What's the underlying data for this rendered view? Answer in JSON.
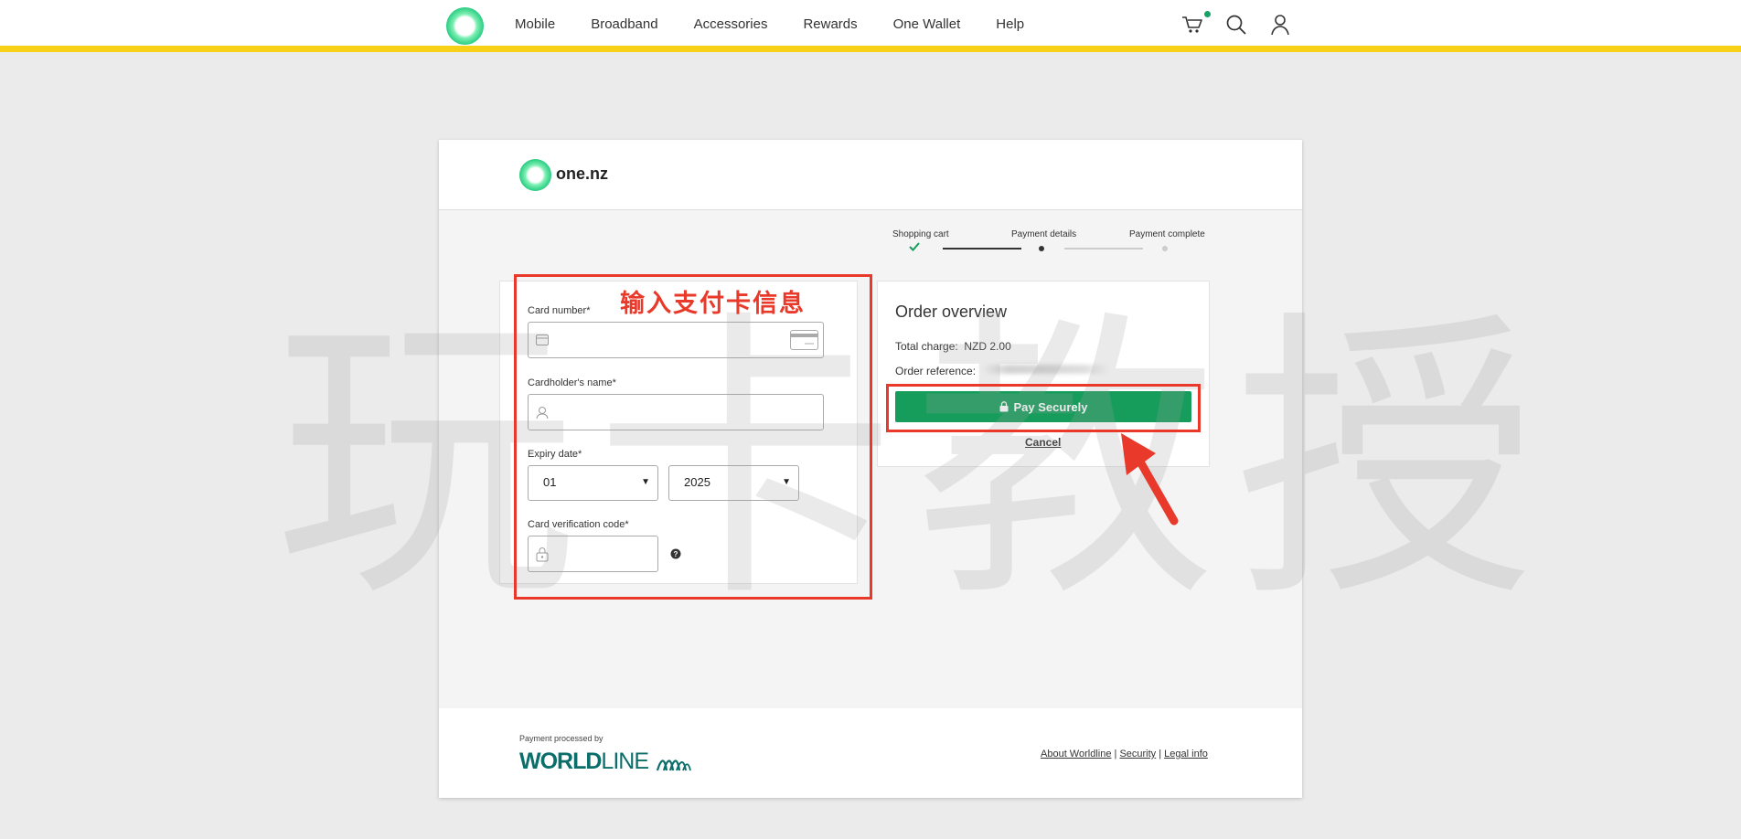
{
  "nav": {
    "links": [
      "Mobile",
      "Broadband",
      "Accessories",
      "Rewards",
      "One Wallet",
      "Help"
    ]
  },
  "brand": {
    "name": "one.nz"
  },
  "steps": {
    "items": [
      "Shopping cart",
      "Payment details",
      "Payment complete"
    ],
    "current": 2
  },
  "form": {
    "card_number_label": "Card number*",
    "cardholder_label": "Cardholder's name*",
    "expiry_label": "Expiry date*",
    "expiry_month": "01",
    "expiry_year": "2025",
    "cvc_label": "Card verification code*"
  },
  "order": {
    "title": "Order overview",
    "total_label": "Total charge:",
    "total_value": "NZD 2.00",
    "reference_label": "Order reference:",
    "pay_label": "Pay Securely",
    "cancel_label": "Cancel"
  },
  "footer": {
    "processed_by": "Payment processed by",
    "worldline_bold": "WORLD",
    "worldline_light": "LINE",
    "links": [
      "About Worldline",
      "Security",
      "Legal info"
    ]
  },
  "annotation": {
    "text": "输入支付卡信息",
    "watermark": "玩卡教授"
  },
  "colors": {
    "accent_yellow": "#f7d117",
    "pay_green": "#169d5c",
    "annotation_red": "#e8392a",
    "worldline_teal": "#0a6e6a"
  }
}
